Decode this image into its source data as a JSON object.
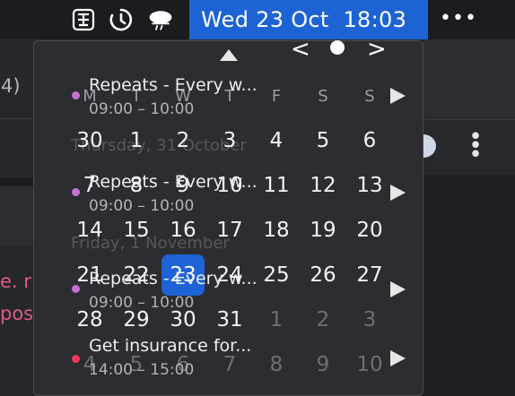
{
  "menubar": {
    "icons": [
      "text-cursor-box-icon",
      "timer-icon",
      "cloud-weather-icon"
    ],
    "clock": "Wed 23 Oct  18:03",
    "more": "•••"
  },
  "background": {
    "partial_text": "4)",
    "red_text_1": "e. r",
    "red_text_2": "pos"
  },
  "calendar": {
    "weekdays": [
      "M",
      "T",
      "W",
      "T",
      "F",
      "S",
      "S"
    ],
    "weeks": [
      [
        "30",
        "1",
        "2",
        "3",
        "4",
        "5",
        "6"
      ],
      [
        "7",
        "8",
        "9",
        "10",
        "11",
        "12",
        "13"
      ],
      [
        "14",
        "15",
        "16",
        "17",
        "18",
        "19",
        "20"
      ],
      [
        "21",
        "22",
        "23",
        "24",
        "25",
        "26",
        "27"
      ],
      [
        "28",
        "29",
        "30",
        "31",
        "1",
        "2",
        "3"
      ],
      [
        "4",
        "5",
        "6",
        "7",
        "8",
        "9",
        "10"
      ]
    ],
    "today": "23",
    "ghost_headers": [
      "Thursday, 31 October",
      "Friday, 1 November"
    ]
  },
  "events": [
    {
      "title": "Repeats - Every w...",
      "time": "09:00 – 10:00",
      "color": "#c86fd6"
    },
    {
      "title": "Repeats - Every w...",
      "time": "09:00 – 10:00",
      "color": "#c86fd6"
    },
    {
      "title": "Repeats - Every w...",
      "time": "09:00 – 10:00",
      "color": "#c86fd6"
    },
    {
      "title": "Get insurance for...",
      "time": "14:00 – 15:00",
      "color": "#f2385a"
    }
  ],
  "colors": {
    "accent": "#1e63d4",
    "today": "#1f63d6"
  }
}
